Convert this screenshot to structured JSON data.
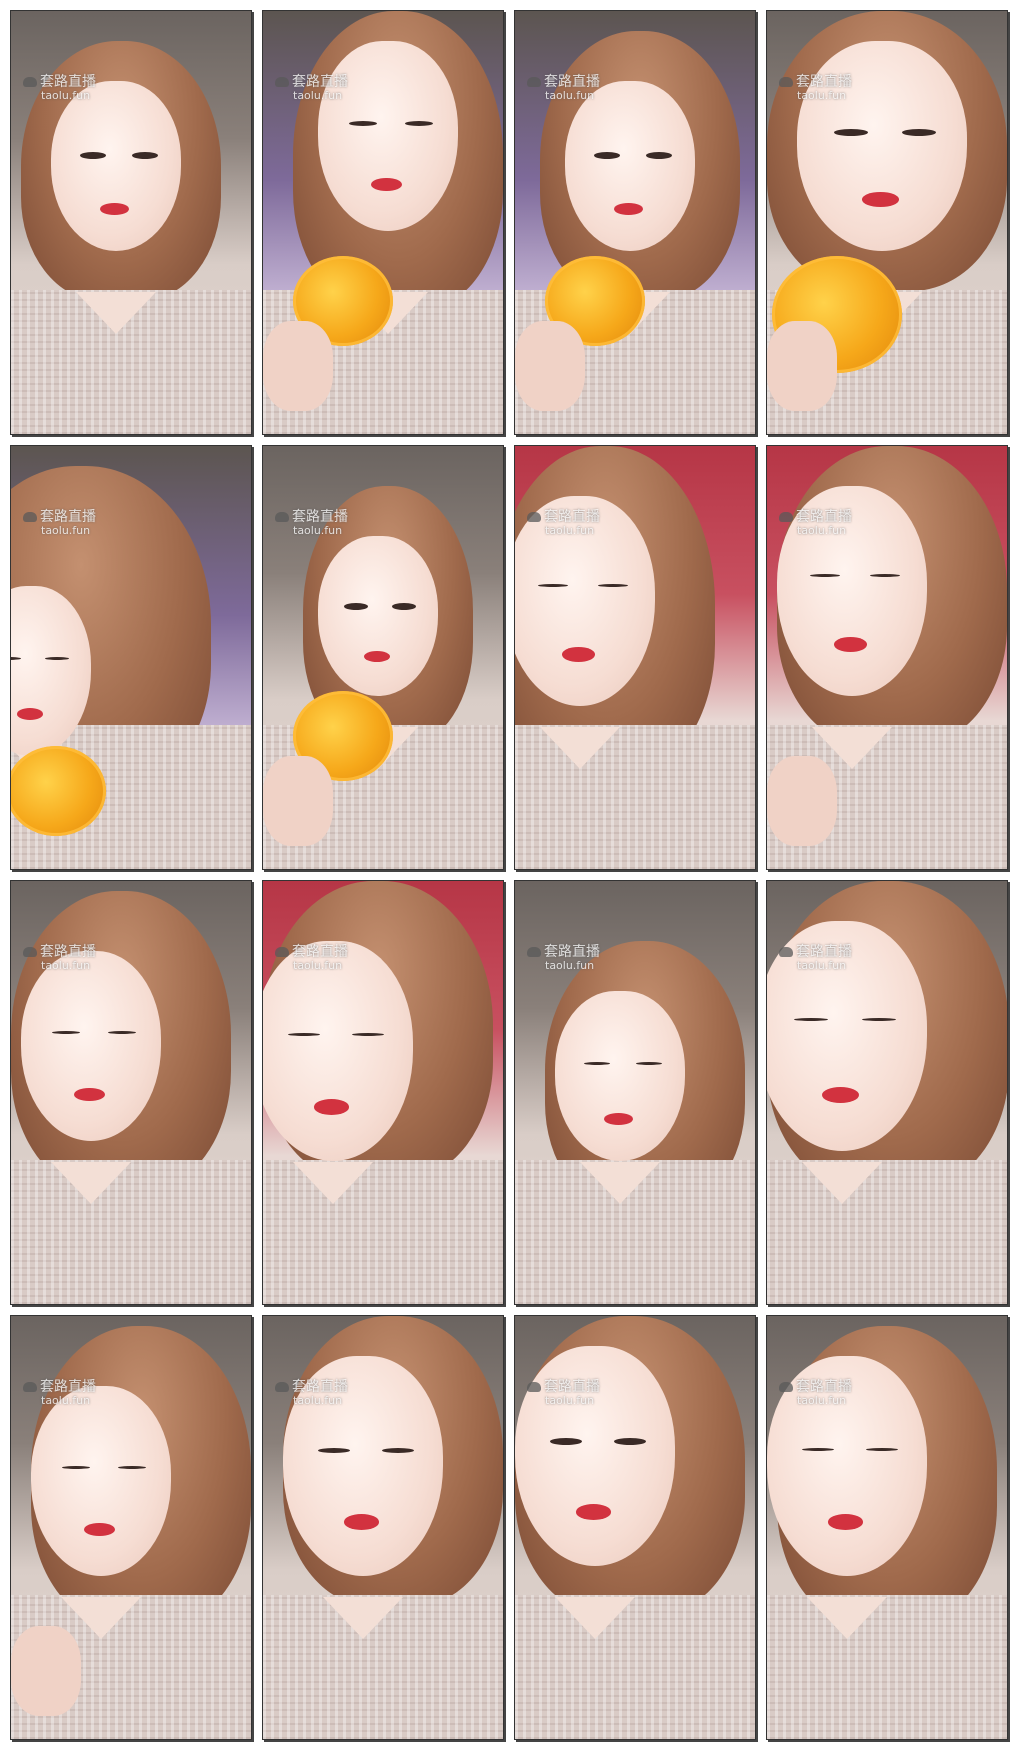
{
  "sheet": {
    "columns": 4,
    "rows": 4,
    "frame_count": 16
  },
  "watermark": {
    "brand_cn": "套路直播",
    "domain": "taolu.fun"
  },
  "frames": [
    {
      "background": "wall",
      "plate": false,
      "hand": false,
      "eyes": "open"
    },
    {
      "background": "purple",
      "plate": true,
      "hand": true,
      "eyes": "half"
    },
    {
      "background": "purple",
      "plate": true,
      "hand": true,
      "eyes": "open"
    },
    {
      "background": "wall",
      "plate": true,
      "hand": true,
      "eyes": "open"
    },
    {
      "background": "purple",
      "plate": true,
      "hand": false,
      "eyes": "closed"
    },
    {
      "background": "wall",
      "plate": true,
      "hand": true,
      "eyes": "open"
    },
    {
      "background": "red",
      "plate": false,
      "hand": false,
      "eyes": "closed"
    },
    {
      "background": "red",
      "plate": false,
      "hand": true,
      "eyes": "closed"
    },
    {
      "background": "wall",
      "plate": false,
      "hand": false,
      "eyes": "closed"
    },
    {
      "background": "red",
      "plate": false,
      "hand": false,
      "eyes": "closed"
    },
    {
      "background": "wall",
      "plate": false,
      "hand": false,
      "eyes": "closed"
    },
    {
      "background": "wall",
      "plate": false,
      "hand": false,
      "eyes": "closed"
    },
    {
      "background": "wall",
      "plate": false,
      "hand": true,
      "eyes": "closed"
    },
    {
      "background": "wall",
      "plate": false,
      "hand": false,
      "eyes": "half"
    },
    {
      "background": "wall",
      "plate": false,
      "hand": false,
      "eyes": "open"
    },
    {
      "background": "wall",
      "plate": false,
      "hand": false,
      "eyes": "closed"
    }
  ],
  "colors": {
    "plate_orange": "#f6a81a",
    "lip_red": "#d2323f",
    "bedspread_red": "#b63646",
    "sofa_purple": "#7e6a9a"
  }
}
